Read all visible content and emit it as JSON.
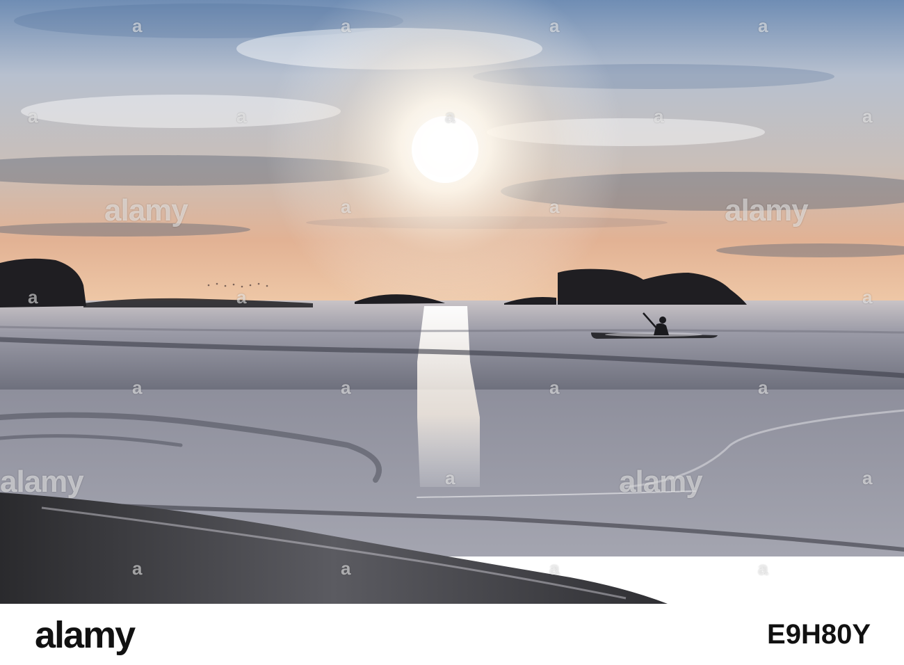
{
  "photo": {
    "subject": "sunset-beach-kayak"
  },
  "watermark": {
    "word": "alamy",
    "small_mark": "a"
  },
  "footer": {
    "brand": "alamy",
    "image_id": "E9H80Y"
  },
  "colors": {
    "sky_top": "#6f8db4",
    "sky_glow": "#fff6e6",
    "horizon": "#e8b48e",
    "sea": "#9a9aa8",
    "sand": "#3a3a3c",
    "footer_bg": "#ffffff",
    "footer_text": "#111111"
  }
}
